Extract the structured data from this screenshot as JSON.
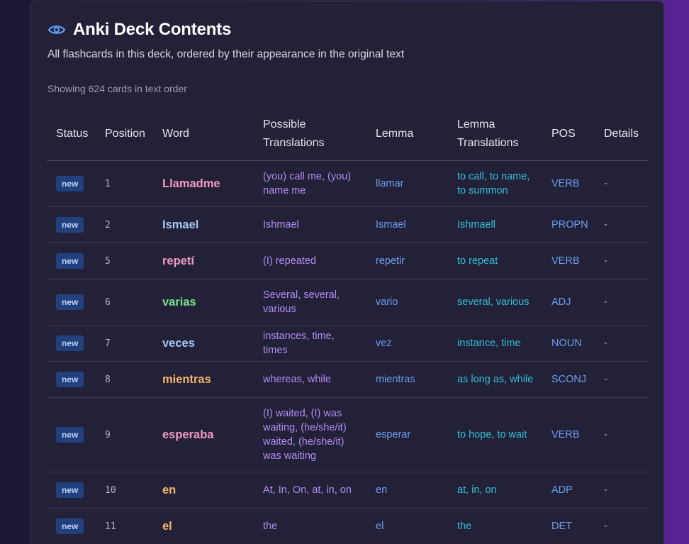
{
  "header": {
    "title": "Anki Deck Contents",
    "subtitle": "All flashcards in this deck, ordered by their appearance in the original text",
    "count_text": "Showing 624 cards in text order",
    "icon": "eye-icon"
  },
  "colors": {
    "accent": "#5b9cf0",
    "badge_bg": "#23407e",
    "translation": "#b48af2",
    "lemma": "#6c9eee",
    "lemma_translation": "#2ebfd6"
  },
  "table": {
    "headers": {
      "status": "Status",
      "position": "Position",
      "word": "Word",
      "translations": "Possible Translations",
      "lemma": "Lemma",
      "lemma_translations": "Lemma Translations",
      "pos": "POS",
      "details": "Details"
    },
    "rows": [
      {
        "status": "new",
        "position": "1",
        "word": "Llamadme",
        "word_color": "#f49ac6",
        "translations": "(you) call me, (you) name me",
        "lemma": "llamar",
        "lemma_translations": "to call, to name, to summon",
        "pos": "VERB",
        "details": "-"
      },
      {
        "status": "new",
        "position": "2",
        "word": "Ismael",
        "word_color": "#a7c8f4",
        "translations": "Ishmael",
        "lemma": "Ismael",
        "lemma_translations": "Ishmaell",
        "pos": "PROPN",
        "details": "-"
      },
      {
        "status": "new",
        "position": "5",
        "word": "repetí",
        "word_color": "#f49ac6",
        "translations": "(I) repeated",
        "lemma": "repetir",
        "lemma_translations": "to repeat",
        "pos": "VERB",
        "details": "-"
      },
      {
        "status": "new",
        "position": "6",
        "word": "varias",
        "word_color": "#7adf8e",
        "translations": "Several, several, various",
        "lemma": "vario",
        "lemma_translations": "several, various",
        "pos": "ADJ",
        "details": "-"
      },
      {
        "status": "new",
        "position": "7",
        "word": "veces",
        "word_color": "#a7c8f4",
        "translations": "instances, time, times",
        "lemma": "vez",
        "lemma_translations": "instance, time",
        "pos": "NOUN",
        "details": "-"
      },
      {
        "status": "new",
        "position": "8",
        "word": "mientras",
        "word_color": "#f6b46a",
        "translations": "whereas, while",
        "lemma": "mientras",
        "lemma_translations": "as long as, while",
        "pos": "SCONJ",
        "details": "-"
      },
      {
        "status": "new",
        "position": "9",
        "word": "esperaba",
        "word_color": "#f49ac6",
        "translations": "(I) waited, (I) was waiting, (he/she/it) waited, (he/she/it) was waiting",
        "lemma": "esperar",
        "lemma_translations": "to hope, to wait",
        "pos": "VERB",
        "details": "-"
      },
      {
        "status": "new",
        "position": "10",
        "word": "en",
        "word_color": "#f6b46a",
        "translations": "At, In, On, at, in, on",
        "lemma": "en",
        "lemma_translations": "at, in, on",
        "pos": "ADP",
        "details": "-"
      },
      {
        "status": "new",
        "position": "11",
        "word": "el",
        "word_color": "#f6b46a",
        "translations": "the",
        "lemma": "el",
        "lemma_translations": "the",
        "pos": "DET",
        "details": "-"
      }
    ]
  }
}
